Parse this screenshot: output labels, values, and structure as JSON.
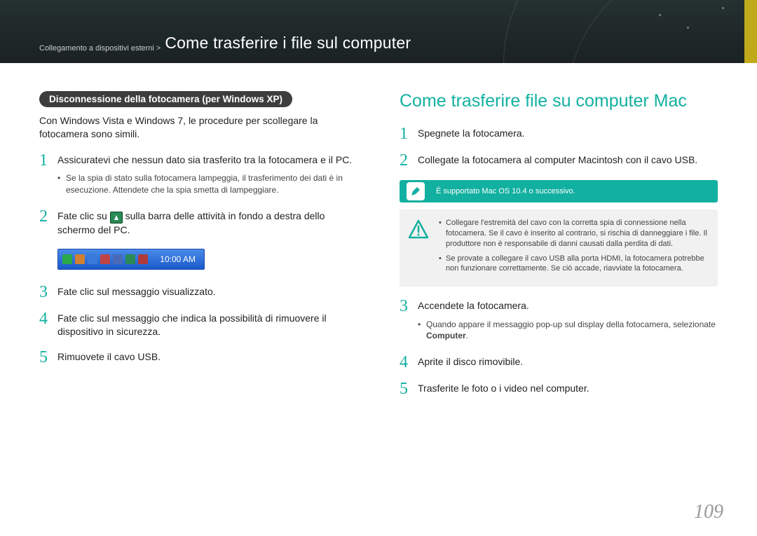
{
  "header": {
    "breadcrumb_small": "Collegamento a dispositivi esterni >",
    "breadcrumb_big": "Come trasferire i file sul computer"
  },
  "left": {
    "pill": "Disconnessione della fotocamera (per Windows XP)",
    "intro": "Con Windows Vista e Windows 7, le procedure per scollegare la fotocamera sono simili.",
    "steps": {
      "1": {
        "num": "1",
        "text": "Assicuratevi che nessun dato sia trasferito tra la fotocamera e il PC.",
        "bullets": [
          "Se la spia di stato sulla fotocamera lampeggia, il trasferimento dei dati è in esecuzione. Attendete che la spia smetta di lampeggiare."
        ]
      },
      "2a": {
        "num": "2",
        "pre": "Fate clic su ",
        "post": " sulla barra delle attività in fondo a destra dello schermo del PC."
      },
      "tray_time": "10:00 AM",
      "3": {
        "num": "3",
        "text": "Fate clic sul messaggio visualizzato."
      },
      "4": {
        "num": "4",
        "text": "Fate clic sul messaggio che indica la possibilità di rimuovere il dispositivo in sicurezza."
      },
      "5": {
        "num": "5",
        "text": "Rimuovete il cavo USB."
      }
    }
  },
  "right": {
    "title": "Come trasferire file su computer Mac",
    "steps": {
      "1": {
        "num": "1",
        "text": "Spegnete la fotocamera."
      },
      "2": {
        "num": "2",
        "text": "Collegate la fotocamera al computer Macintosh con il cavo USB."
      },
      "note": "È supportato Mac OS 10.4 o successivo.",
      "warn": [
        "Collegare l'estremità del cavo con la corretta spia di connessione nella fotocamera. Se il cavo è inserito al contrario, si rischia di danneggiare i file. Il produttore non è responsabile di danni causati dalla perdita di dati.",
        "Se provate a collegare il cavo USB alla porta HDMI, la fotocamera potrebbe non funzionare correttamente. Se ciò accade, riavviate la fotocamera."
      ],
      "3": {
        "num": "3",
        "text": "Accendete la fotocamera.",
        "bullets_pre": "Quando appare il messaggio pop-up sul display della fotocamera, selezionate ",
        "bold": "Computer",
        "bullets_post": "."
      },
      "4": {
        "num": "4",
        "text": "Aprite il disco rimovibile."
      },
      "5": {
        "num": "5",
        "text": "Trasferite le foto o i video nel computer."
      }
    }
  },
  "page_number": "109"
}
